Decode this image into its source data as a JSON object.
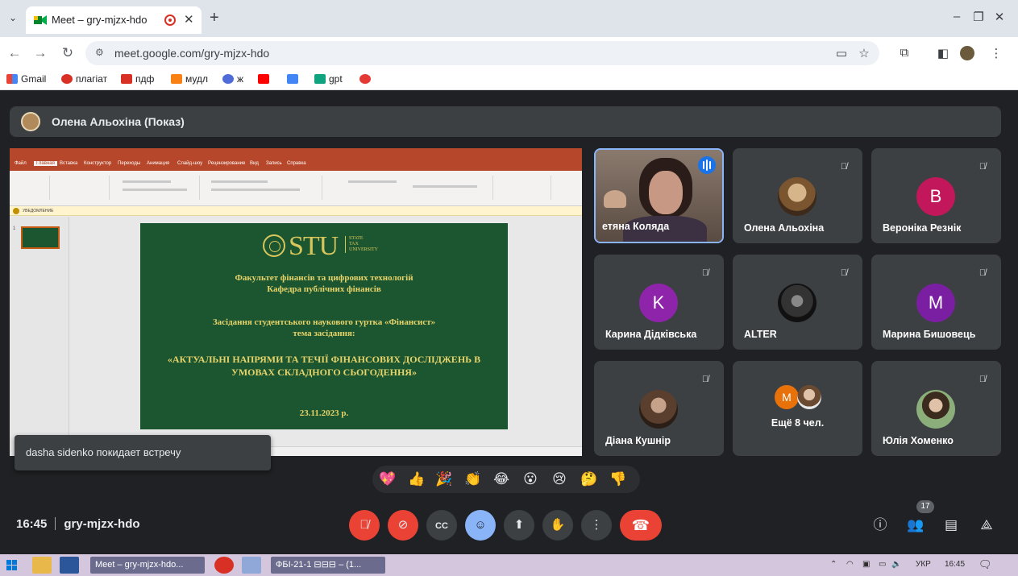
{
  "browser": {
    "tab_title": "Meet – gry-mjzx-hdo",
    "url": "meet.google.com/gry-mjzx-hdo",
    "bookmarks": [
      "Gmail",
      "плагіат",
      "пдф",
      "мудл",
      "ж",
      "gpt"
    ]
  },
  "meet": {
    "presenter_banner": "Олена Альохіна (Показ)",
    "meeting_code": "gry-mjzx-hdo",
    "time": "16:45",
    "people_count": "17",
    "toast": "dasha sidenko покидает встречу",
    "more_people_label": "Ещё 8 чел."
  },
  "participants": [
    {
      "name": "Тетяна Коляда",
      "tile_label": "етяна Коляда",
      "speaking": true
    },
    {
      "name": "Олена Альохіна",
      "tile_label": "Олена Альохіна"
    },
    {
      "name": "Вероніка Резнік",
      "tile_label": "Вероніка Резнік",
      "initial": "B",
      "color": "#c2185b"
    },
    {
      "name": "Карина Дідківська",
      "tile_label": "Карина Дідківська",
      "initial": "K",
      "color": "#8e24aa"
    },
    {
      "name": "ALTER",
      "tile_label": "ALTER"
    },
    {
      "name": "Марина Бишовець",
      "tile_label": "Марина Бишовець",
      "initial": "M",
      "color": "#7b1fa2"
    },
    {
      "name": "Діана Кушнір",
      "tile_label": "Діана Кушнір"
    },
    {
      "name": "Юлія Хоменко",
      "tile_label": "Юлія Хоменко"
    }
  ],
  "more_avatar_initial": "M",
  "slide": {
    "logo_text": "STU",
    "logo_sub": [
      "STATE",
      "TAX",
      "UNIVERSITY"
    ],
    "faculty": "Факультет фінансів та цифрових технологій",
    "department": "Кафедра публічних фінансів",
    "meeting": "Засідання студентського наукового гуртка «Фінансист»",
    "topic_label": "тема засідання:",
    "topic_line1": "«АКТУАЛЬНІ НАПРЯМИ ТА ТЕЧІЇ ФІНАНСОВИХ ДОСЛІДЖЕНЬ В",
    "topic_line2": "УМОВАХ СКЛАДНОГО СЬОГОДЕННЯ»",
    "date": "23.11.2023 р."
  },
  "powerpoint": {
    "ribbon_tabs": [
      "Файл",
      "Главная",
      "Вставка",
      "Конструктор",
      "Переходы",
      "Анимация",
      "Слайд-шоу",
      "Рецензирование",
      "Вид",
      "Запись",
      "Справка"
    ],
    "notice_label": "УВЕДОМЛЕНИЕ",
    "thumb_number": "1"
  },
  "taskbar": {
    "chrome_item": "Meet – gry-mjzx-hdo...",
    "doc_item": "ФБІ-21-1 ⊟⊟⊟ – (1...",
    "lang": "УКР",
    "clock": "16:45"
  },
  "colors": {
    "meet_bg": "#202124",
    "tile_bg": "#3c4043",
    "danger": "#ea4335",
    "accent": "#8ab4f8",
    "slide_bg": "#1c5631",
    "slide_text": "#e6d36a"
  }
}
